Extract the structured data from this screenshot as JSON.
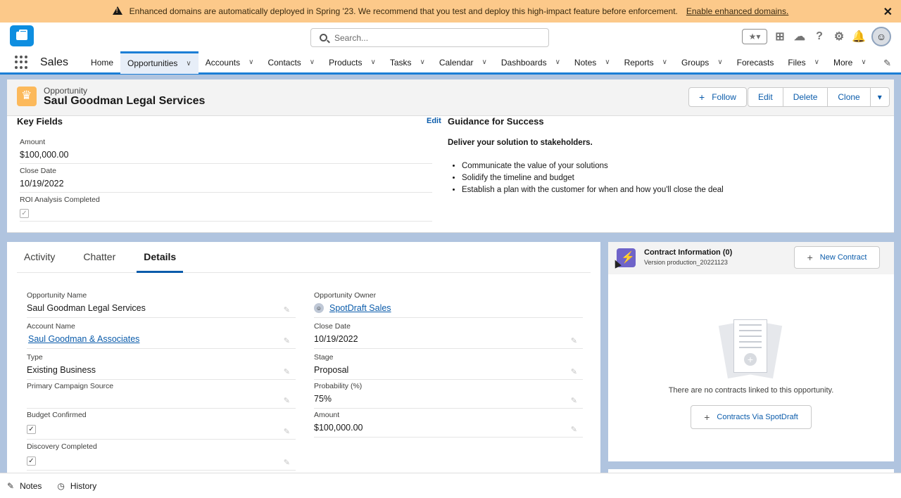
{
  "banner": {
    "message": "Enhanced domains are automatically deployed in Spring '23. We recommend that you test and deploy this high-impact feature before enforcement.",
    "link": "Enable enhanced domains.",
    "close": "✕"
  },
  "header": {
    "search_placeholder": "Search...",
    "favorites_icon": "★▾",
    "icons": [
      "add-icon",
      "trailhead-icon",
      "help-icon",
      "setup-icon",
      "bell-icon"
    ]
  },
  "nav": {
    "app_name": "Sales",
    "items": [
      {
        "label": "Home",
        "chevron": false,
        "active": false
      },
      {
        "label": "Opportunities",
        "chevron": true,
        "active": true
      },
      {
        "label": "Accounts",
        "chevron": true,
        "active": false
      },
      {
        "label": "Contacts",
        "chevron": true,
        "active": false
      },
      {
        "label": "Products",
        "chevron": true,
        "active": false
      },
      {
        "label": "Tasks",
        "chevron": true,
        "active": false
      },
      {
        "label": "Calendar",
        "chevron": true,
        "active": false
      },
      {
        "label": "Dashboards",
        "chevron": true,
        "active": false
      },
      {
        "label": "Notes",
        "chevron": true,
        "active": false
      },
      {
        "label": "Reports",
        "chevron": true,
        "active": false
      },
      {
        "label": "Groups",
        "chevron": true,
        "active": false
      },
      {
        "label": "Forecasts",
        "chevron": false,
        "active": false
      },
      {
        "label": "Files",
        "chevron": true,
        "active": false
      },
      {
        "label": "More",
        "chevron": true,
        "active": false
      }
    ]
  },
  "record": {
    "type": "Opportunity",
    "name": "Saul Goodman Legal Services",
    "actions": {
      "follow": "Follow",
      "edit": "Edit",
      "delete": "Delete",
      "clone": "Clone",
      "more": "▾"
    }
  },
  "key_fields": {
    "title": "Key Fields",
    "edit": "Edit",
    "amount_label": "Amount",
    "amount_value": "$100,000.00",
    "close_date_label": "Close Date",
    "close_date_value": "10/19/2022",
    "roi_label": "ROI Analysis Completed",
    "roi_checked": true
  },
  "guidance": {
    "title": "Guidance for Success",
    "subtitle": "Deliver your solution to stakeholders.",
    "items": [
      "Communicate the value of your solutions",
      "Solidify the timeline and budget",
      "Establish a plan with the customer for when and how you'll close the deal"
    ]
  },
  "tabs": [
    "Activity",
    "Chatter",
    "Details"
  ],
  "details": {
    "opp_name_label": "Opportunity Name",
    "opp_name_value": "Saul Goodman Legal Services",
    "owner_label": "Opportunity Owner",
    "owner_value": "SpotDraft Sales",
    "account_label": "Account Name",
    "account_value": "Saul Goodman & Associates",
    "close_date_label": "Close Date",
    "close_date_value": "10/19/2022",
    "type_label": "Type",
    "type_value": "Existing Business",
    "stage_label": "Stage",
    "stage_value": "Proposal",
    "campaign_label": "Primary Campaign Source",
    "campaign_value": "",
    "probability_label": "Probability (%)",
    "probability_value": "75%",
    "budget_label": "Budget Confirmed",
    "budget_checked": true,
    "amount_label": "Amount",
    "amount_value": "$100,000.00",
    "discovery_label": "Discovery Completed",
    "discovery_checked": true
  },
  "contracts": {
    "title": "Contract Information (0)",
    "version": "Version production_20221123",
    "new_button": "New Contract",
    "empty_text": "There are no contracts linked to this opportunity.",
    "via_button": "Contracts Via SpotDraft"
  },
  "utility_bar": {
    "notes": "Notes",
    "history": "History"
  },
  "colors": {
    "brand_blue": "#0b5cab",
    "nav_accent": "#1b7ed6",
    "banner_bg": "#fcc98a",
    "opportunity_icon": "#fcb95b",
    "contract_icon": "#6f64c9"
  }
}
